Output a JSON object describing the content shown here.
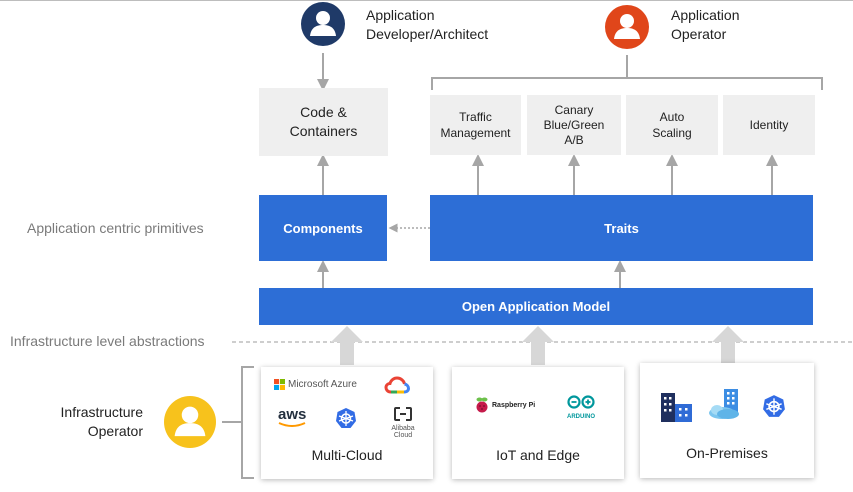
{
  "personas": {
    "developer": {
      "line1": "Application",
      "line2": "Developer/Architect",
      "color": "#1f3a68"
    },
    "operator": {
      "line1": "Application",
      "line2": "Operator",
      "color": "#e0461a"
    },
    "infra": {
      "line1": "Infrastructure",
      "line2": "Operator",
      "color": "#f7c21c"
    }
  },
  "boxes": {
    "code": {
      "line1": "Code &",
      "line2": "Containers"
    },
    "traffic": {
      "line1": "Traffic",
      "line2": "Management"
    },
    "canary": {
      "line1": "Canary",
      "line2": "Blue/Green",
      "line3": "A/B"
    },
    "autoscaling": {
      "line1": "Auto",
      "line2": "Scaling"
    },
    "identity": {
      "line1": "Identity"
    },
    "components": "Components",
    "traits": "Traits",
    "oam": "Open Application Model"
  },
  "side_labels": {
    "app_centric": "Application centric primitives",
    "infra_level": "Infrastructure level abstractions"
  },
  "cards": {
    "multicloud": {
      "label": "Multi-Cloud",
      "logos": {
        "azure": "Microsoft Azure",
        "aws": "aws",
        "alibaba": "Alibaba Cloud"
      }
    },
    "iot": {
      "label": "IoT and Edge",
      "logos": {
        "raspberry": "Raspberry Pi",
        "arduino": "ARDUINO"
      }
    },
    "onprem": {
      "label": "On-Premises"
    }
  },
  "icons": {
    "persona": "person-icon",
    "gcp": "google-cloud-icon",
    "kubernetes": "kubernetes-icon",
    "buildings": "building-icon",
    "cloud_building": "cloud-building-icon"
  },
  "colors": {
    "blue": "#2d6ed6",
    "gray_box": "#efefef",
    "arrow": "#a6a6a6"
  }
}
